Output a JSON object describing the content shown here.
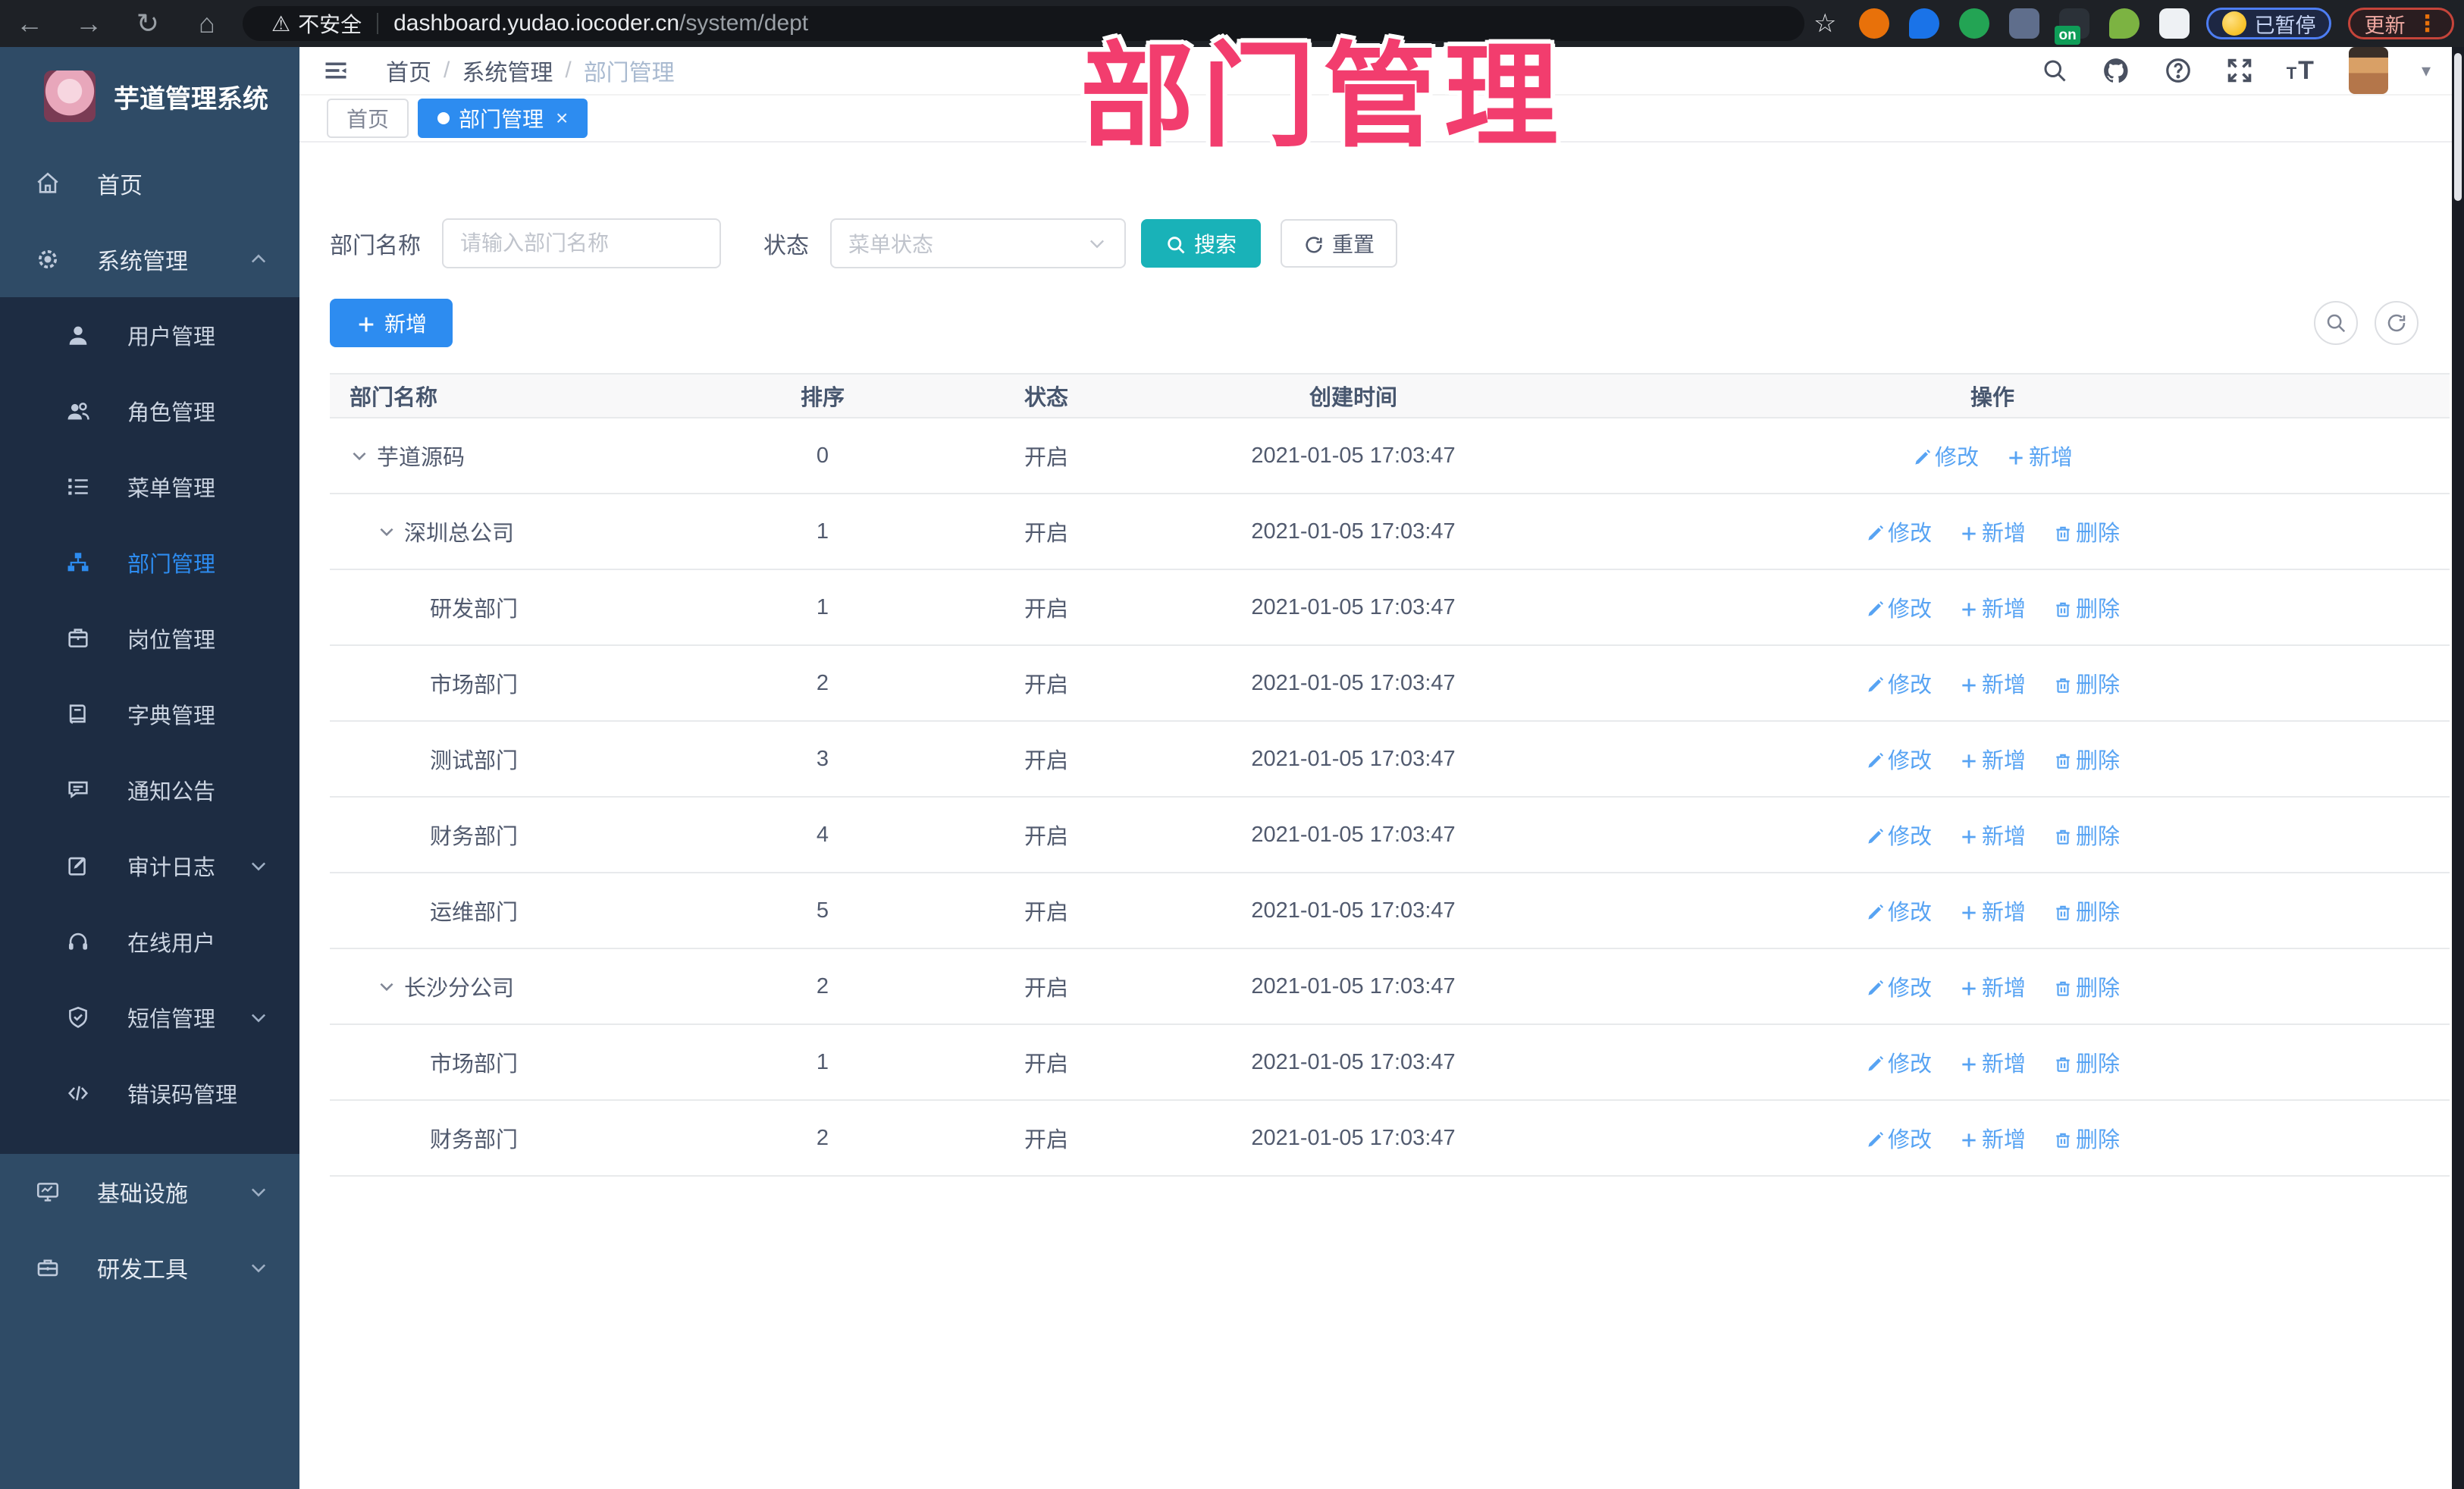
{
  "browser": {
    "security_label": "不安全",
    "url_host": "dashboard.yudao.iocoder.cn",
    "url_path": "/system/dept",
    "paused_label": "已暂停",
    "update_label": "更新",
    "extensions": [
      {
        "name": "ext-target-icon",
        "color": "#e8710a",
        "shape": "circle"
      },
      {
        "name": "ext-drop-icon",
        "color": "#1a73e8",
        "shape": "drop"
      },
      {
        "name": "ext-check-icon",
        "color": "#23a454",
        "shape": "circle"
      },
      {
        "name": "ext-grid-icon",
        "color": "#5f6e8c",
        "shape": "square"
      },
      {
        "name": "ext-proxy-icon",
        "color": "#2b3138",
        "shape": "square",
        "badge": "on"
      },
      {
        "name": "ext-person-icon",
        "color": "#7cb342",
        "shape": "drop"
      },
      {
        "name": "ext-puzzle-icon",
        "color": "#eef1f4",
        "shape": "square"
      }
    ]
  },
  "watermark": "部门管理",
  "sidebar": {
    "logo_title": "芋道管理系统",
    "items": [
      {
        "icon": "home-icon",
        "label": "首页",
        "type": "root"
      },
      {
        "icon": "gear-icon",
        "label": "系统管理",
        "type": "root",
        "chevron": "up"
      },
      {
        "icon": "user-icon",
        "label": "用户管理",
        "type": "sub"
      },
      {
        "icon": "users-icon",
        "label": "角色管理",
        "type": "sub"
      },
      {
        "icon": "menu-list-icon",
        "label": "菜单管理",
        "type": "sub"
      },
      {
        "icon": "org-tree-icon",
        "label": "部门管理",
        "type": "sub",
        "active": true
      },
      {
        "icon": "badge-icon",
        "label": "岗位管理",
        "type": "sub"
      },
      {
        "icon": "dict-book-icon",
        "label": "字典管理",
        "type": "sub"
      },
      {
        "icon": "notice-icon",
        "label": "通知公告",
        "type": "sub"
      },
      {
        "icon": "audit-log-icon",
        "label": "审计日志",
        "type": "sub",
        "chevron": "down"
      },
      {
        "icon": "online-user-icon",
        "label": "在线用户",
        "type": "sub"
      },
      {
        "icon": "sms-icon",
        "label": "短信管理",
        "type": "sub",
        "chevron": "down"
      },
      {
        "icon": "code-icon",
        "label": "错误码管理",
        "type": "sub"
      },
      {
        "icon": "infra-icon",
        "label": "基础设施",
        "type": "root",
        "chevron": "down"
      },
      {
        "icon": "devtools-icon",
        "label": "研发工具",
        "type": "root",
        "chevron": "down"
      }
    ]
  },
  "header": {
    "breadcrumb": {
      "home": "首页",
      "parent": "系统管理",
      "current": "部门管理"
    }
  },
  "tabs": {
    "home_label": "首页",
    "active_label": "部门管理"
  },
  "query": {
    "name_label": "部门名称",
    "name_placeholder": "请输入部门名称",
    "status_label": "状态",
    "status_placeholder": "菜单状态",
    "search_label": "搜索",
    "reset_label": "重置"
  },
  "toolbar": {
    "add_label": "新增"
  },
  "table": {
    "columns": {
      "name": "部门名称",
      "sort": "排序",
      "status": "状态",
      "created": "创建时间",
      "actions": "操作"
    },
    "action_labels": {
      "edit": "修改",
      "add": "新增",
      "delete": "删除"
    },
    "rows": [
      {
        "name": "芋道源码",
        "level": 0,
        "expandable": true,
        "sort": "0",
        "status": "开启",
        "created": "2021-01-05 17:03:47",
        "actions": [
          "edit",
          "add"
        ]
      },
      {
        "name": "深圳总公司",
        "level": 1,
        "expandable": true,
        "sort": "1",
        "status": "开启",
        "created": "2021-01-05 17:03:47",
        "actions": [
          "edit",
          "add",
          "delete"
        ]
      },
      {
        "name": "研发部门",
        "level": 2,
        "expandable": false,
        "sort": "1",
        "status": "开启",
        "created": "2021-01-05 17:03:47",
        "actions": [
          "edit",
          "add",
          "delete"
        ]
      },
      {
        "name": "市场部门",
        "level": 2,
        "expandable": false,
        "sort": "2",
        "status": "开启",
        "created": "2021-01-05 17:03:47",
        "actions": [
          "edit",
          "add",
          "delete"
        ]
      },
      {
        "name": "测试部门",
        "level": 2,
        "expandable": false,
        "sort": "3",
        "status": "开启",
        "created": "2021-01-05 17:03:47",
        "actions": [
          "edit",
          "add",
          "delete"
        ]
      },
      {
        "name": "财务部门",
        "level": 2,
        "expandable": false,
        "sort": "4",
        "status": "开启",
        "created": "2021-01-05 17:03:47",
        "actions": [
          "edit",
          "add",
          "delete"
        ]
      },
      {
        "name": "运维部门",
        "level": 2,
        "expandable": false,
        "sort": "5",
        "status": "开启",
        "created": "2021-01-05 17:03:47",
        "actions": [
          "edit",
          "add",
          "delete"
        ]
      },
      {
        "name": "长沙分公司",
        "level": 1,
        "expandable": true,
        "sort": "2",
        "status": "开启",
        "created": "2021-01-05 17:03:47",
        "actions": [
          "edit",
          "add",
          "delete"
        ]
      },
      {
        "name": "市场部门",
        "level": 2,
        "expandable": false,
        "sort": "1",
        "status": "开启",
        "created": "2021-01-05 17:03:47",
        "actions": [
          "edit",
          "add",
          "delete"
        ]
      },
      {
        "name": "财务部门",
        "level": 2,
        "expandable": false,
        "sort": "2",
        "status": "开启",
        "created": "2021-01-05 17:03:47",
        "actions": [
          "edit",
          "add",
          "delete"
        ]
      }
    ]
  },
  "colors": {
    "accent_blue": "#2d8cf0",
    "search_button_teal": "#19b2b8",
    "action_link_blue": "#57a3f3",
    "watermark_pink": "#f23d6e",
    "sidebar_base": "#2f4b66",
    "sidebar_submenu": "#1d2c42"
  }
}
